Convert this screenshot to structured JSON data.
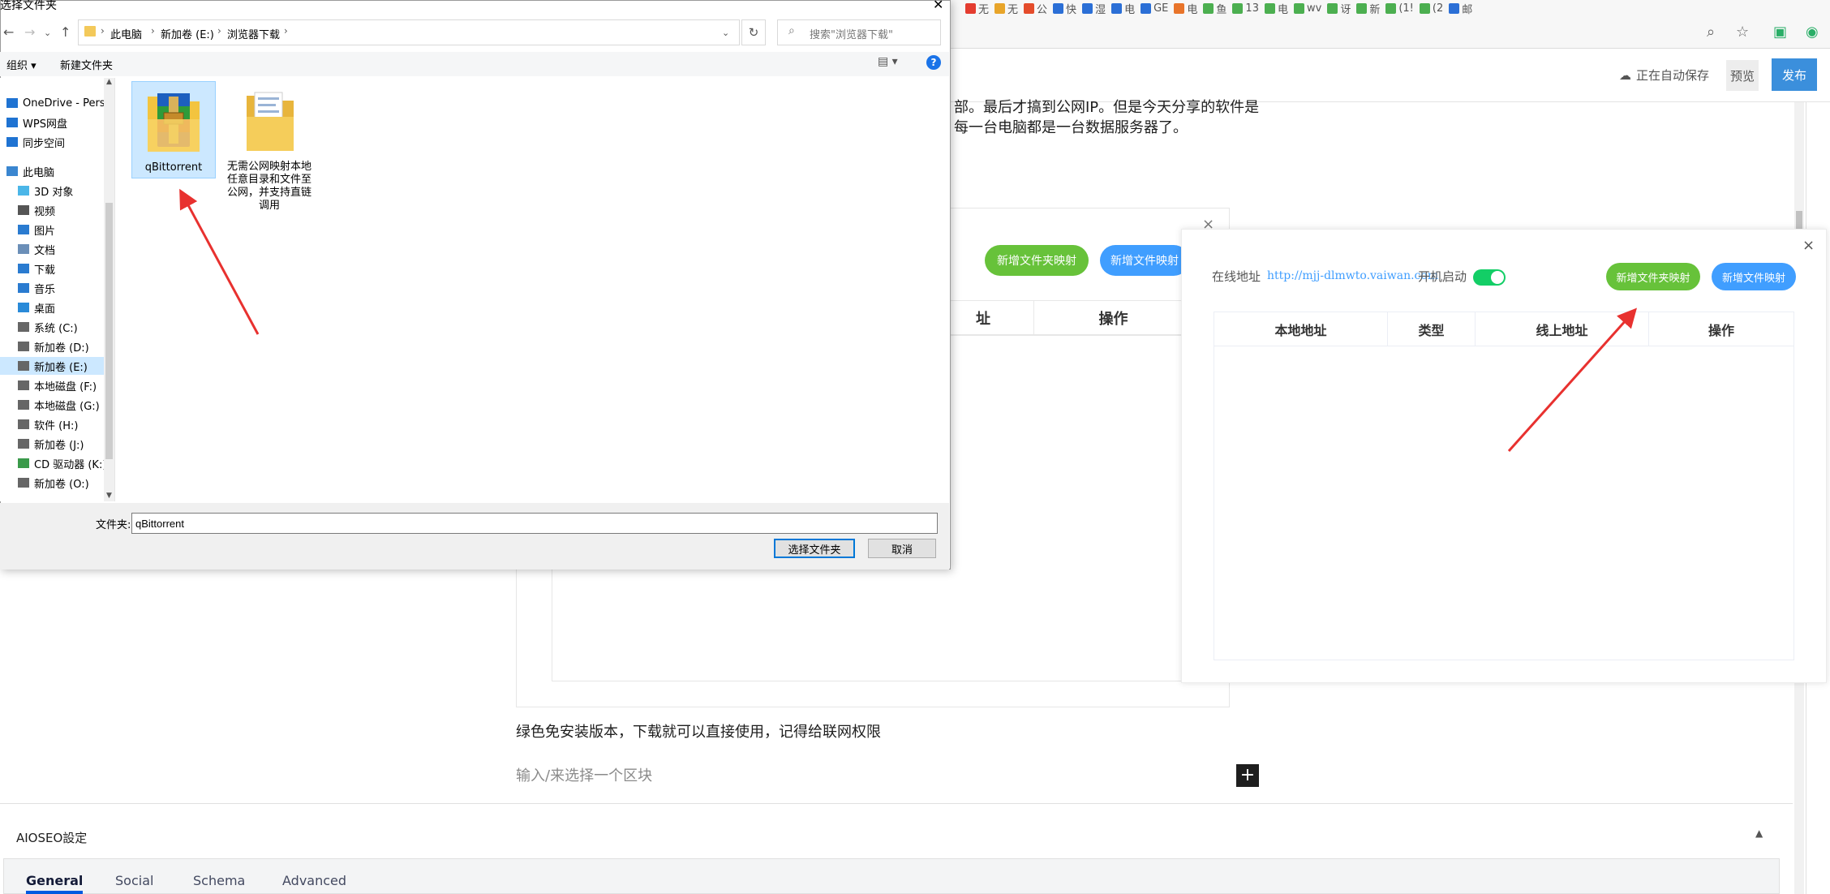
{
  "browser": {
    "bookmarks": [
      "无",
      "无",
      "公",
      "快",
      "湿",
      "电",
      "GE",
      "电",
      "鱼",
      "13",
      "电",
      "wv",
      "讶",
      "新",
      "(1!",
      "(2",
      "邮"
    ],
    "bookmark_colors": [
      "#e43d30",
      "#e8a52a",
      "#e44c2b",
      "#2b6fd6",
      "#2b6fd6",
      "#2b6fd6",
      "#2b6fd6",
      "#e8742a",
      "#4caf50",
      "#4caf50",
      "#4caf50",
      "#4caf50",
      "#4caf50",
      "#4caf50",
      "#4caf50",
      "#4caf50",
      "#2b6fd6"
    ],
    "zoom_icon": "zoom-icon",
    "favorite_icon": "favorite-icon",
    "extension_icons": [
      "wechat-icon",
      "extension-icon"
    ]
  },
  "editor": {
    "autosave_label": "正在自动保存",
    "preview_label": "预览",
    "publish_label": "发布",
    "para_top_line1": "部。最后才搞到公网IP。但是今天分享的软件是",
    "para_top_line2": "每一台电脑都是一台数据服务器了。",
    "para_green": "绿色免安装版本，下载就可以直接使用，记得给联网权限",
    "block_input_placeholder": "输入/来选择一个区块",
    "plus_label": "+"
  },
  "embedded_image": {
    "btn_add_folder_mapping": "新增文件夹映射",
    "btn_add_file_mapping": "新增文件映射",
    "col_online_addr_partial": "址",
    "col_action": "操作",
    "close": "×"
  },
  "popup": {
    "online_addr_label": "在线地址",
    "online_addr_url": "http://mjj-dlmwto.vaiwan.com",
    "autostart_label": "开机启动",
    "autostart_on": true,
    "btn_add_folder_mapping": "新增文件夹映射",
    "btn_add_file_mapping": "新增文件映射",
    "close": "×",
    "columns": [
      "本地地址",
      "类型",
      "线上地址",
      "操作"
    ],
    "accent_green": "#67c23a",
    "accent_blue": "#409eff"
  },
  "aioseo": {
    "title": "AIOSEO設定",
    "tabs": [
      "General",
      "Social",
      "Schema",
      "Advanced"
    ],
    "active_tab": "General"
  },
  "file_dialog": {
    "title": "选择文件夹",
    "breadcrumb": [
      "此电脑",
      "新加卷 (E:)",
      "浏览器下载"
    ],
    "search_placeholder": "搜索\"浏览器下载\"",
    "toolbar_organize": "组织 ▾",
    "toolbar_new_folder": "新建文件夹",
    "nav_items": [
      {
        "label": "OneDrive - Perso",
        "icon": "cloud-icon"
      },
      {
        "label": "WPS网盘",
        "icon": "cloud-icon"
      },
      {
        "label": "同步空间",
        "icon": "sync-icon"
      },
      {
        "label": "此电脑",
        "icon": "computer-icon"
      },
      {
        "label": "3D 对象",
        "icon": "cube-icon"
      },
      {
        "label": "视频",
        "icon": "video-icon"
      },
      {
        "label": "图片",
        "icon": "picture-icon"
      },
      {
        "label": "文档",
        "icon": "document-icon"
      },
      {
        "label": "下载",
        "icon": "download-icon"
      },
      {
        "label": "音乐",
        "icon": "music-icon"
      },
      {
        "label": "桌面",
        "icon": "desktop-icon"
      },
      {
        "label": "系统 (C:)",
        "icon": "drive-icon"
      },
      {
        "label": "新加卷 (D:)",
        "icon": "drive-icon"
      },
      {
        "label": "新加卷 (E:)",
        "icon": "drive-icon"
      },
      {
        "label": "本地磁盘 (F:)",
        "icon": "drive-icon"
      },
      {
        "label": "本地磁盘 (G:)",
        "icon": "drive-icon"
      },
      {
        "label": "软件 (H:)",
        "icon": "drive-icon"
      },
      {
        "label": "新加卷 (J:)",
        "icon": "drive-icon"
      },
      {
        "label": "CD 驱动器 (K:) l",
        "icon": "cd-icon"
      },
      {
        "label": "新加卷 (O:)",
        "icon": "drive-icon"
      }
    ],
    "selected_nav": "新加卷 (E:)",
    "files": [
      {
        "name": "qBittorrent",
        "icon": "winrar-folder-icon"
      },
      {
        "name": "无需公网映射本地任意目录和文件至公网，并支持直链调用",
        "icon": "folder-icon"
      }
    ],
    "selected_file": "qBittorrent",
    "filename_label": "文件夹:",
    "filename_value": "qBittorrent",
    "btn_select": "选择文件夹",
    "btn_cancel": "取消"
  }
}
